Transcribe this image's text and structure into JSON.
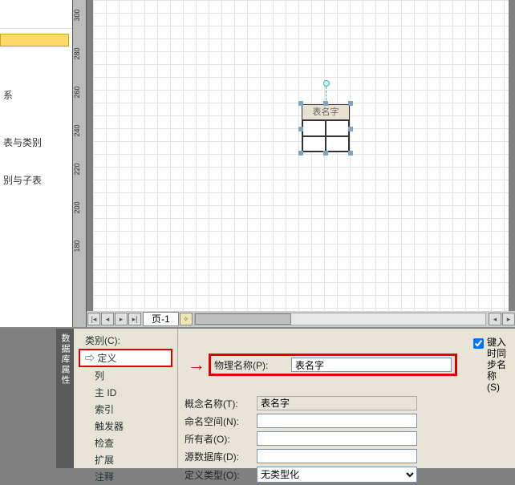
{
  "left_panel": {
    "item1": "系",
    "item2": "表与类别",
    "item3": "别与子表"
  },
  "ruler_ticks": [
    "300",
    "280",
    "260",
    "240",
    "220",
    "200",
    "180"
  ],
  "shape": {
    "title": "表名字"
  },
  "tabs": {
    "page1": "页-1"
  },
  "tree": {
    "root": "类别(C):",
    "selected": "定义",
    "items": [
      "列",
      "主 ID",
      "索引",
      "触发器",
      "检查",
      "扩展",
      "注释"
    ]
  },
  "form": {
    "phys_name_label": "物理名称(P):",
    "phys_name_value": "表名字",
    "concept_name_label": "概念名称(T):",
    "concept_name_value": "表名字",
    "namespace_label": "命名空间(N):",
    "namespace_value": "",
    "owner_label": "所有者(O):",
    "owner_value": "",
    "source_db_label": "源数据库(D):",
    "source_db_value": "",
    "def_type_label": "定义类型(O):",
    "def_type_value": "无类型化",
    "sync_label": "键入时同步名称(S)"
  }
}
